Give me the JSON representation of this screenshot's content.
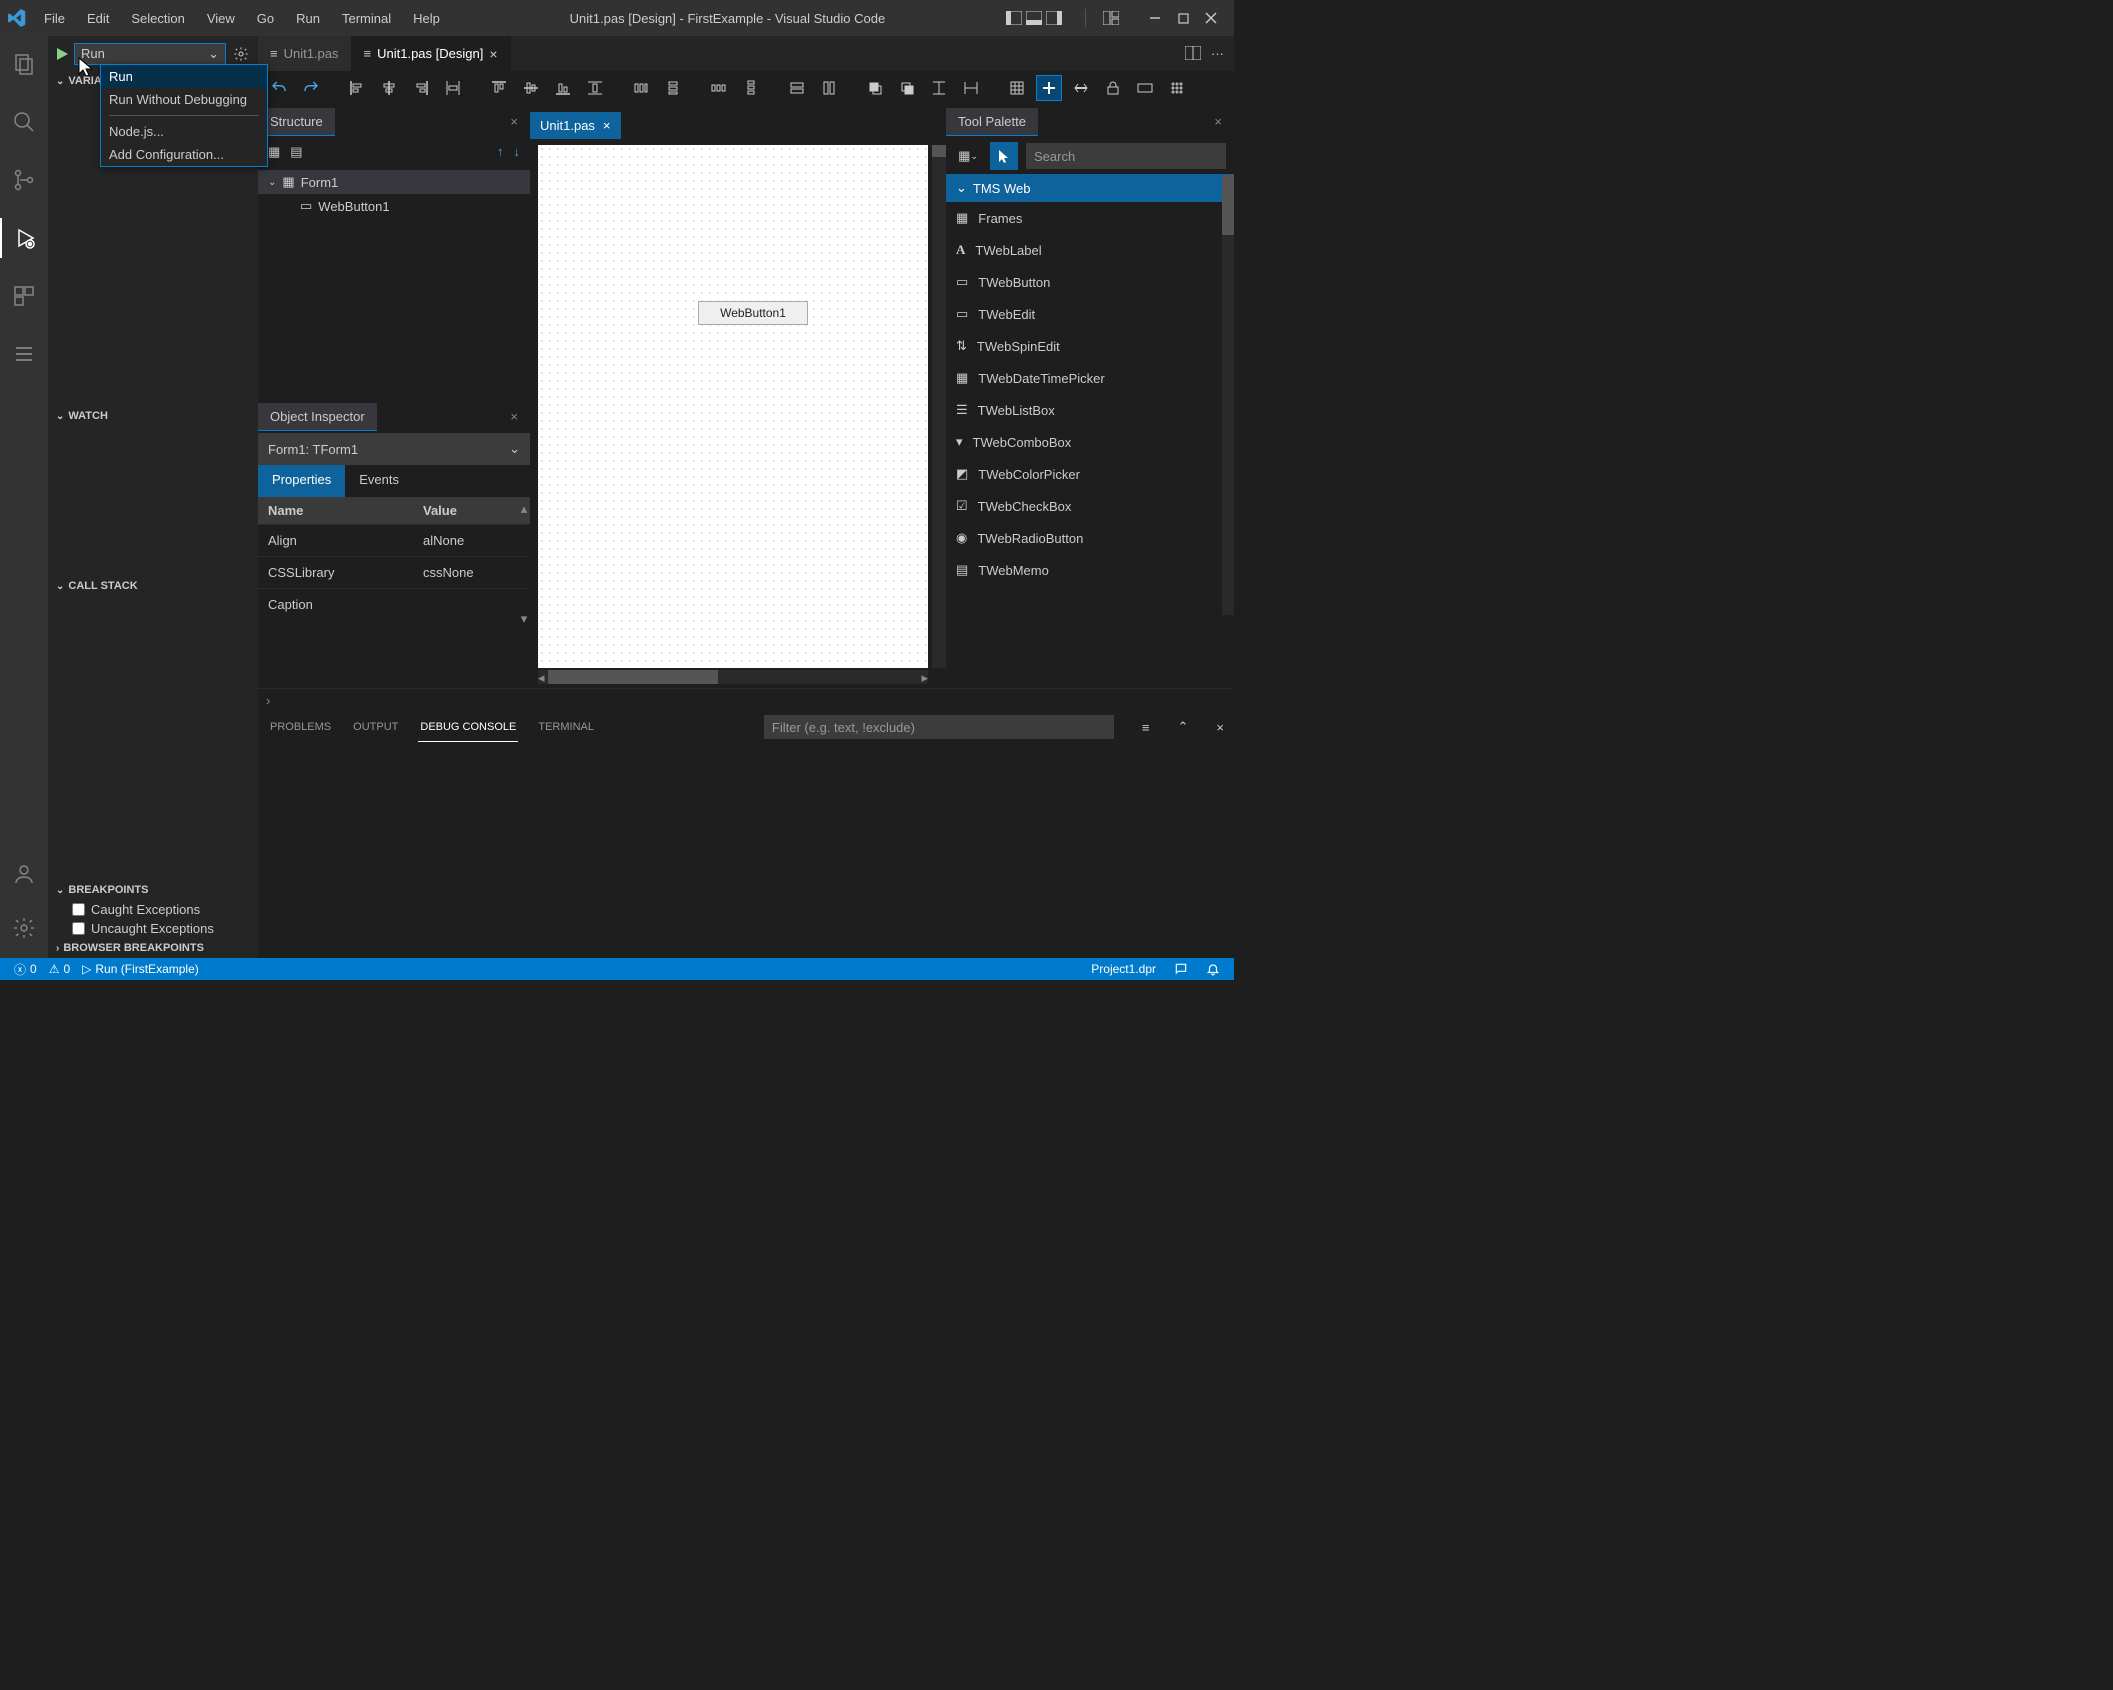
{
  "titlebar": {
    "menus": [
      "File",
      "Edit",
      "Selection",
      "View",
      "Go",
      "Run",
      "Terminal",
      "Help"
    ],
    "title": "Unit1.pas [Design] - FirstExample - Visual Studio Code"
  },
  "run": {
    "selected": "Run",
    "dropdown": {
      "items_top": [
        "Run",
        "Run Without Debugging"
      ],
      "items_bottom": [
        "Node.js...",
        "Add Configuration..."
      ]
    }
  },
  "sidebar": {
    "sections": {
      "variables": "VARIABLES",
      "watch": "WATCH",
      "callstack": "CALL STACK",
      "breakpoints": "BREAKPOINTS",
      "browser_breakpoints": "BROWSER BREAKPOINTS"
    },
    "breakpoints": {
      "caught": "Caught Exceptions",
      "uncaught": "Uncaught Exceptions"
    }
  },
  "tabs": {
    "tab1": "Unit1.pas",
    "tab2": "Unit1.pas [Design]"
  },
  "structure": {
    "title": "Structure",
    "root": "Form1",
    "children": [
      "WebButton1"
    ]
  },
  "inspector": {
    "title": "Object Inspector",
    "selected": "Form1: TForm1",
    "tabs": {
      "props": "Properties",
      "events": "Events"
    },
    "columns": {
      "name": "Name",
      "value": "Value"
    },
    "rows": [
      {
        "name": "Align",
        "value": "alNone"
      },
      {
        "name": "CSSLibrary",
        "value": "cssNone"
      },
      {
        "name": "Caption",
        "value": ""
      }
    ]
  },
  "designer": {
    "tab": "Unit1.pas",
    "button_caption": "WebButton1"
  },
  "palette": {
    "title": "Tool Palette",
    "search_placeholder": "Search",
    "category": "TMS Web",
    "items": [
      "Frames",
      "TWebLabel",
      "TWebButton",
      "TWebEdit",
      "TWebSpinEdit",
      "TWebDateTimePicker",
      "TWebListBox",
      "TWebComboBox",
      "TWebColorPicker",
      "TWebCheckBox",
      "TWebRadioButton",
      "TWebMemo"
    ]
  },
  "bottom": {
    "tabs": {
      "problems": "PROBLEMS",
      "output": "OUTPUT",
      "debug": "DEBUG CONSOLE",
      "terminal": "TERMINAL"
    },
    "filter_placeholder": "Filter (e.g. text, !exclude)"
  },
  "status": {
    "errors": "0",
    "warnings": "0",
    "run": "Run (FirstExample)",
    "project": "Project1.dpr"
  }
}
